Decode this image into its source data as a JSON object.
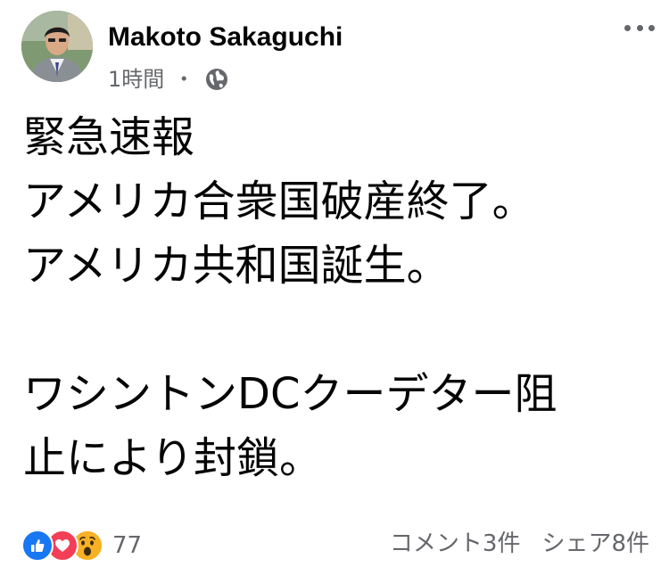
{
  "post": {
    "author": "Makoto Sakaguchi",
    "time": "1時間",
    "separator": "・",
    "privacy_icon": "globe-icon",
    "more_icon": "more-dots-icon",
    "text_lines": [
      "緊急速報",
      "アメリカ合衆国破産終了。",
      "アメリカ共和国誕生。",
      "",
      "ワシントンDCクーデター阻",
      "止により封鎖。"
    ]
  },
  "footer": {
    "reaction_icons": [
      "like-icon",
      "love-icon",
      "wow-icon"
    ],
    "reaction_count": "77",
    "comments": "コメント3件",
    "shares": "シェア8件"
  },
  "colors": {
    "like": "#1877f2",
    "love": "#f33e58",
    "wow": "#f7b125",
    "secondary_text": "#65676b"
  }
}
